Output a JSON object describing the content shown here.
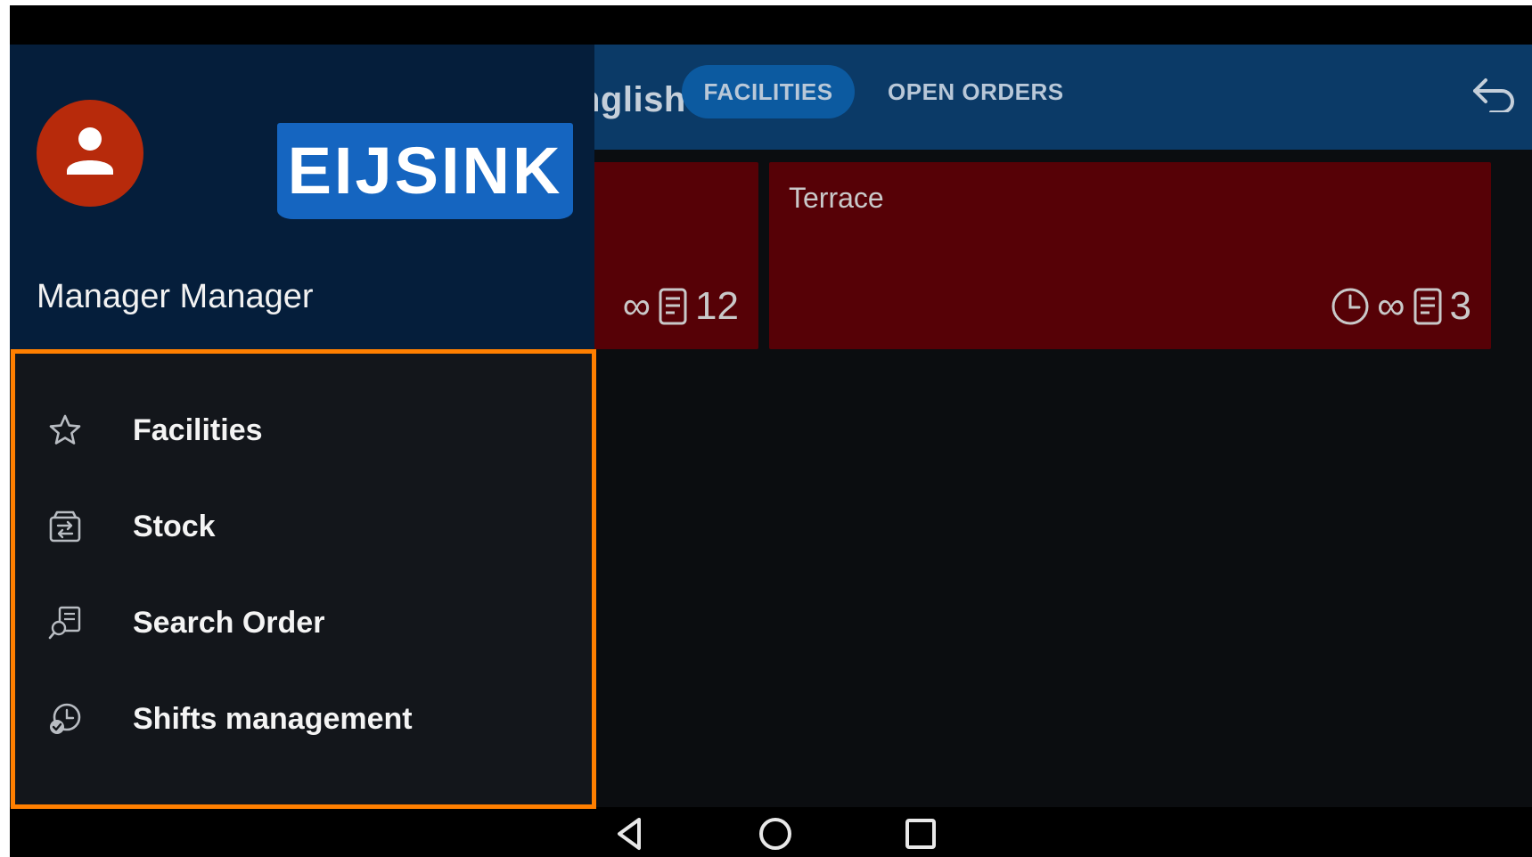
{
  "appbar": {
    "language_text": "nglish",
    "tabs": [
      {
        "label": "FACILITIES",
        "active": true
      },
      {
        "label": "OPEN ORDERS",
        "active": false
      }
    ]
  },
  "cards": [
    {
      "title": "",
      "infinity": "∞",
      "count": "12"
    },
    {
      "title": "Terrace",
      "infinity": "∞",
      "count": "3"
    }
  ],
  "drawer": {
    "logo_text": "EIJSINK",
    "user_name": "Manager Manager",
    "menu": [
      {
        "label": "Facilities",
        "icon": "star-outline-icon"
      },
      {
        "label": "Stock",
        "icon": "stock-transfer-icon"
      },
      {
        "label": "Search Order",
        "icon": "search-order-icon"
      },
      {
        "label": "Shifts management",
        "icon": "shift-clock-icon"
      }
    ]
  },
  "colors": {
    "appbar": "#0b3a67",
    "drawer_header": "#051e3b",
    "avatar": "#b72a0b",
    "logo": "#1565c0",
    "card": "#560106",
    "highlight": "#ff7f00"
  }
}
